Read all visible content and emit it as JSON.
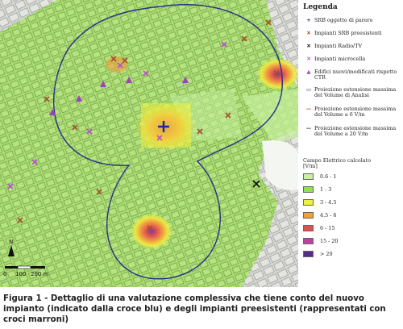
{
  "legend": {
    "title": "Legenda",
    "items": [
      {
        "symbol": "+",
        "color": "#1a2a9a",
        "label": "SRB oggetto di parere",
        "icon": "cross-plus-icon"
      },
      {
        "symbol": "✕",
        "color": "#a0522d",
        "label": "Impianti SRB preesistenti",
        "icon": "brown-x-icon"
      },
      {
        "symbol": "✕",
        "color": "#111111",
        "label": "Impianti Radio/TV",
        "icon": "black-x-icon"
      },
      {
        "symbol": "✕",
        "color": "#b84fc9",
        "label": "Impianti microcella",
        "icon": "purple-x-icon"
      },
      {
        "symbol": "▲",
        "color": "#a040c0",
        "label": "Edifici nuovi/modificati rispetto CTR",
        "icon": "triangle-icon"
      },
      {
        "symbol": "▭",
        "color": "#2b2f8a",
        "label": "Proiezione estensione massima del Volume di Analisi",
        "icon": "rect-outline-icon"
      },
      {
        "symbol": "—",
        "color": "#c0502a",
        "label": "Proiezione estensione massima del Volume a 6 V/m",
        "icon": "line-red-icon"
      },
      {
        "symbol": "—",
        "color": "#333333",
        "label": "Proiezione estensione massima del Volume a 20 V/m",
        "icon": "line-black-icon"
      }
    ],
    "field_title": "Campo Elettrico calcolato [V/m]",
    "field_classes": [
      {
        "label": "0.6 - 1",
        "color": "#c8f0a0"
      },
      {
        "label": "1 - 3",
        "color": "#90e050"
      },
      {
        "label": "3 - 4.5",
        "color": "#f0f040"
      },
      {
        "label": "4.5 - 6",
        "color": "#f0a040"
      },
      {
        "label": "6 - 15",
        "color": "#e05050"
      },
      {
        "label": "15 - 20",
        "color": "#c040a0"
      },
      {
        "label": "> 20",
        "color": "#5a2a8a"
      }
    ]
  },
  "scale": {
    "north": "N",
    "labels": [
      "0",
      "100",
      "200 m"
    ]
  },
  "caption": "Figura 1 - Dettaglio di una valutazione complessiva che tiene conto del nuovo impianto (indicato dalla croce blu) e degli impianti preesistenti (rappresentati con croci marroni)",
  "colors": {
    "green": "#a8e070",
    "grey_map": "#cfd2d0",
    "blue_line": "#2b2f8a"
  }
}
